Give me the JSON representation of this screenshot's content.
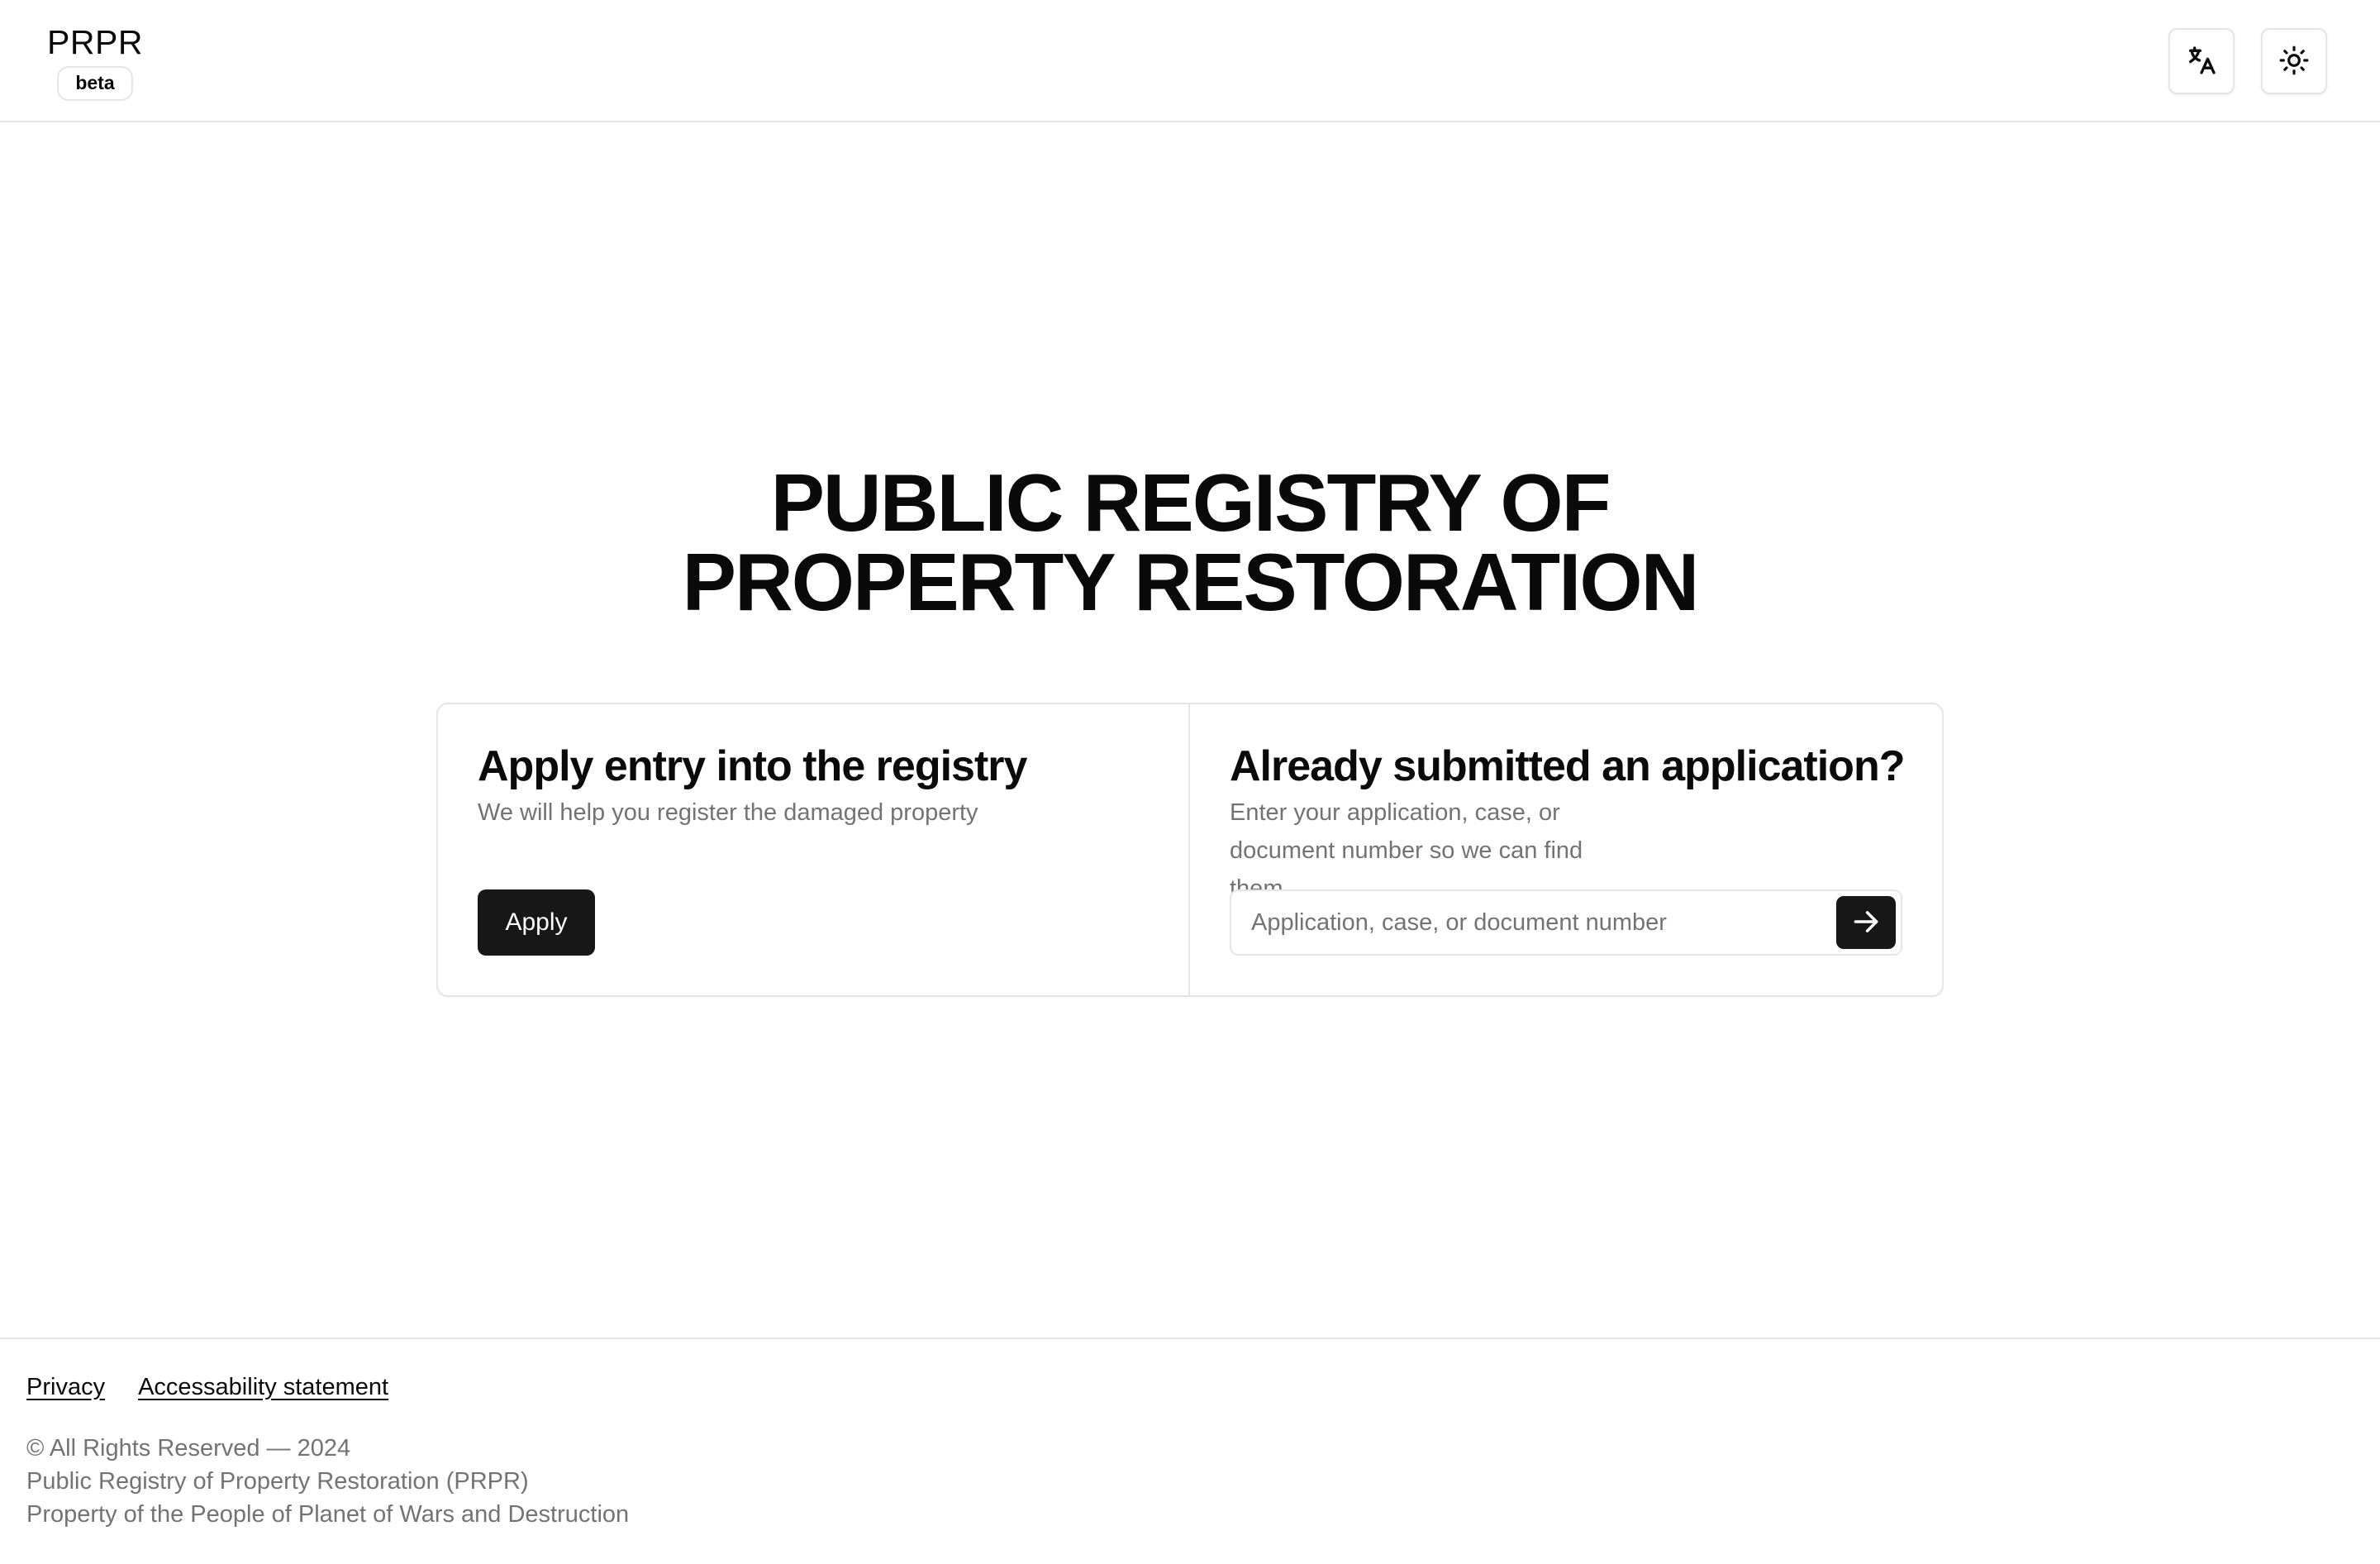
{
  "header": {
    "brand": "PRPR",
    "badge": "beta",
    "language_button_icon": "translate-icon",
    "theme_button_icon": "sun-icon"
  },
  "hero": {
    "title_line1": "PUBLIC REGISTRY OF",
    "title_line2": "PROPERTY RESTORATION"
  },
  "apply_panel": {
    "title": "Apply entry into the registry",
    "description": "We will help you register the damaged property",
    "button_label": "Apply"
  },
  "lookup_panel": {
    "title": "Already submitted an application?",
    "description": "Enter your application, case, or document number so we can find them",
    "input_value": "",
    "input_placeholder": "Application, case, or document number",
    "submit_icon": "arrow-right-icon"
  },
  "footer": {
    "links": [
      "Privacy",
      "Accessability statement"
    ],
    "lines": [
      "© All Rights Reserved — 2024",
      "Public Registry of Property Restoration (PRPR)",
      "Property of the People of Planet of Wars and Destruction"
    ]
  },
  "colors": {
    "primary": "#171717",
    "border": "#e5e5e5",
    "muted_text": "#737373",
    "background": "#ffffff"
  }
}
